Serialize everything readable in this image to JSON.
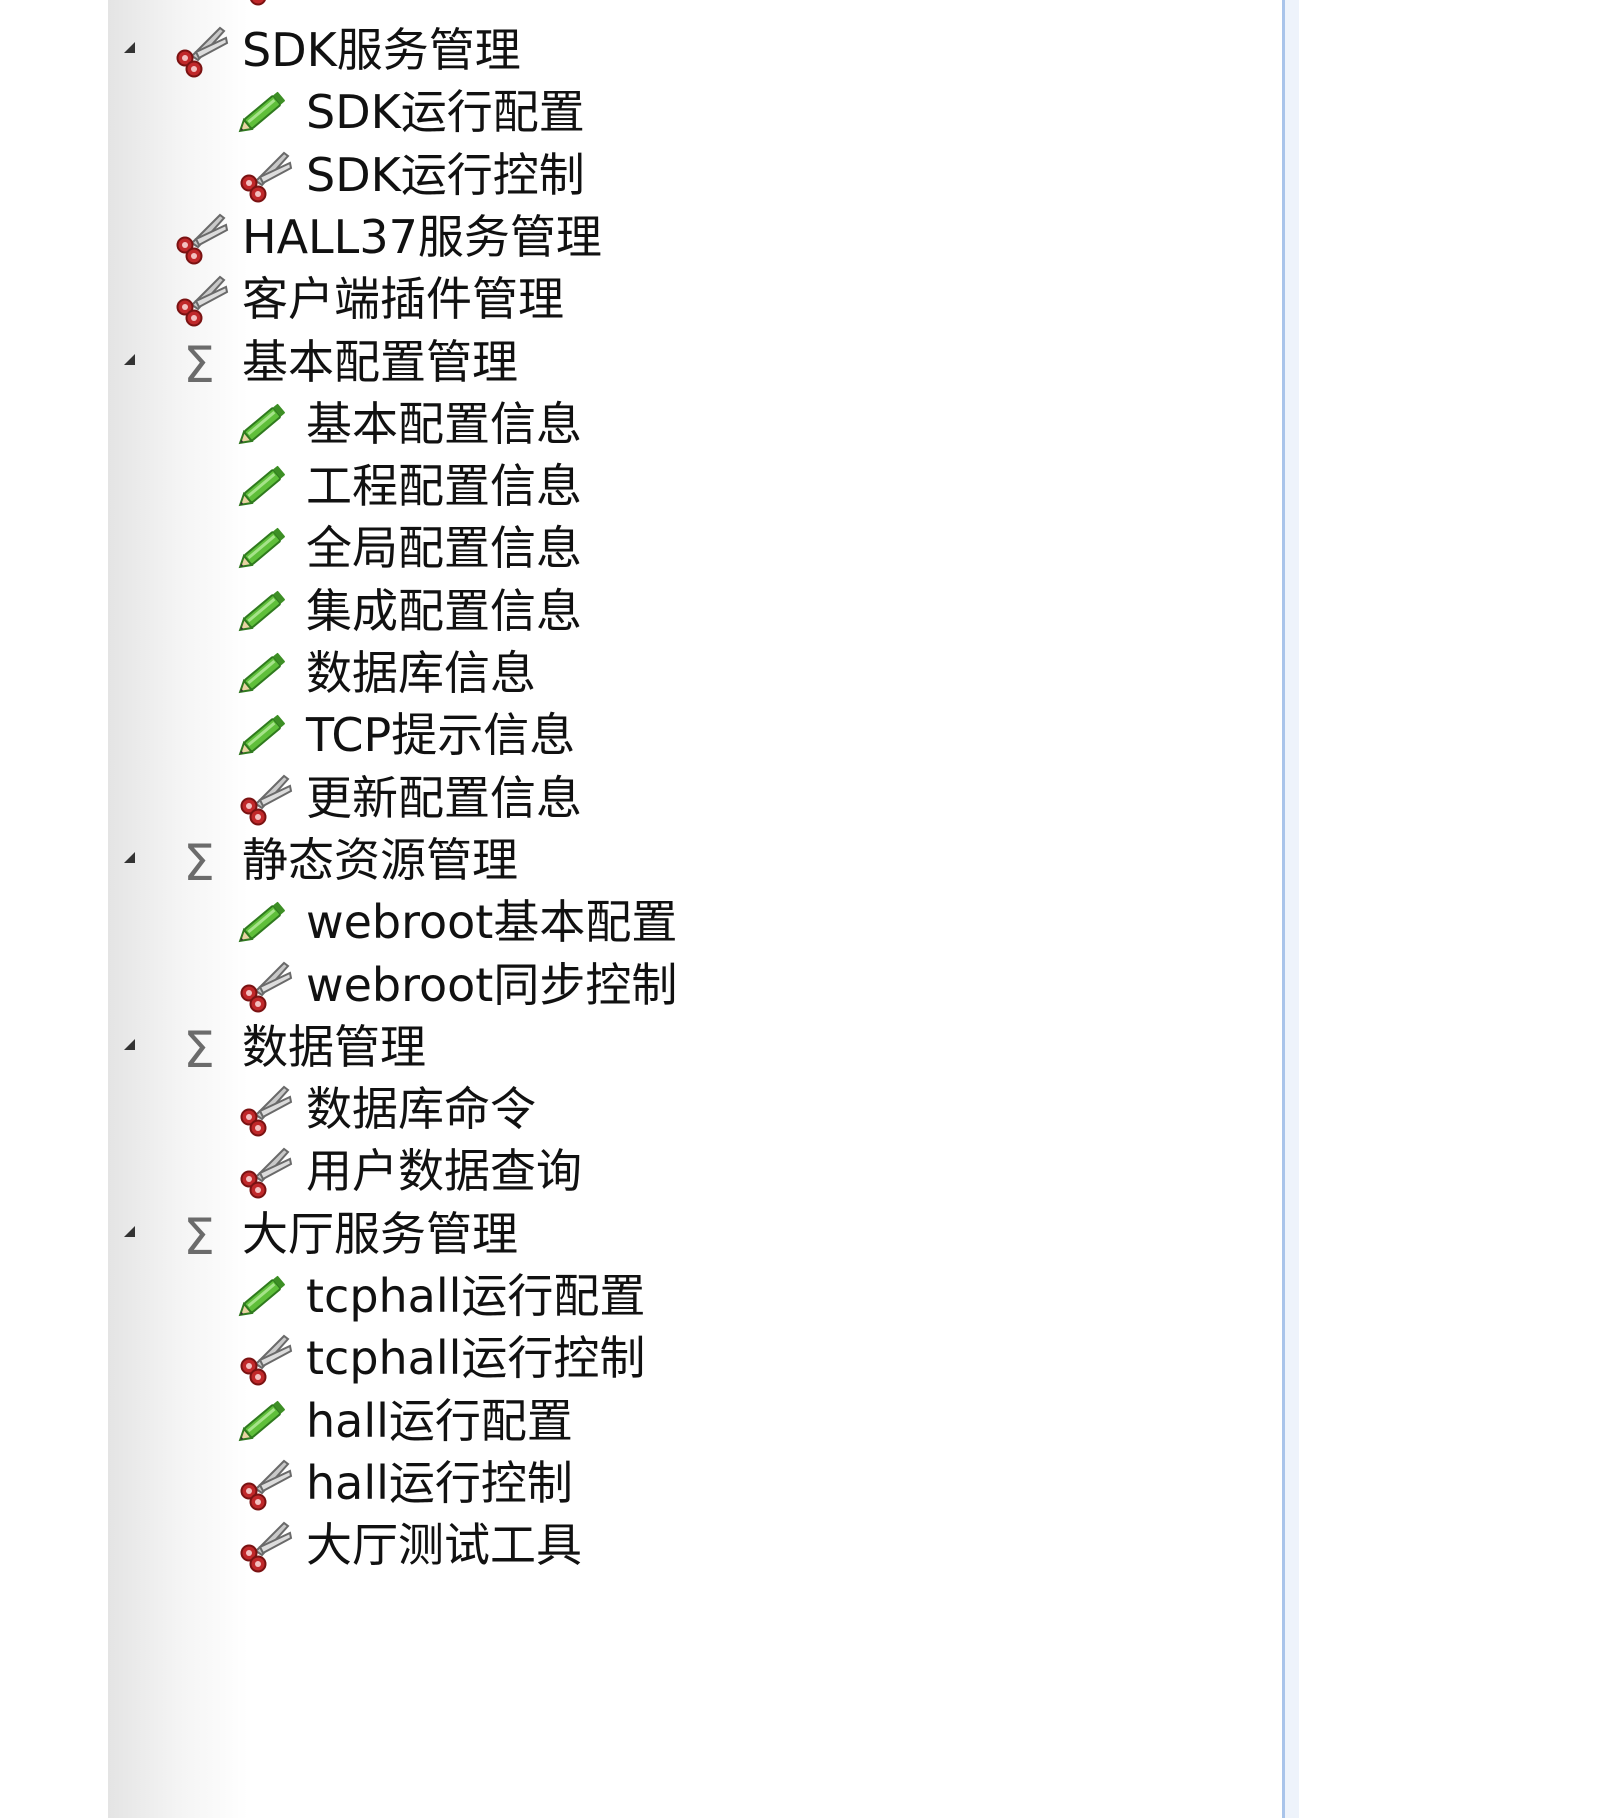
{
  "tree": {
    "items": [
      {
        "label": "SDK服务管理",
        "level": 1,
        "icon": "scissors-icon",
        "expanded": true
      },
      {
        "label": "SDK运行配置",
        "level": 2,
        "icon": "pencil-icon"
      },
      {
        "label": "SDK运行控制",
        "level": 2,
        "icon": "scissors-icon"
      },
      {
        "label": "HALL37服务管理",
        "level": 1,
        "icon": "scissors-icon"
      },
      {
        "label": "客户端插件管理",
        "level": 1,
        "icon": "scissors-icon"
      },
      {
        "label": "基本配置管理",
        "level": 1,
        "icon": "sigma-icon",
        "expanded": true
      },
      {
        "label": "基本配置信息",
        "level": 2,
        "icon": "pencil-icon"
      },
      {
        "label": "工程配置信息",
        "level": 2,
        "icon": "pencil-icon"
      },
      {
        "label": "全局配置信息",
        "level": 2,
        "icon": "pencil-icon"
      },
      {
        "label": "集成配置信息",
        "level": 2,
        "icon": "pencil-icon"
      },
      {
        "label": "数据库信息",
        "level": 2,
        "icon": "pencil-icon"
      },
      {
        "label": "TCP提示信息",
        "level": 2,
        "icon": "pencil-icon"
      },
      {
        "label": "更新配置信息",
        "level": 2,
        "icon": "scissors-icon"
      },
      {
        "label": "静态资源管理",
        "level": 1,
        "icon": "sigma-icon",
        "expanded": true
      },
      {
        "label": "webroot基本配置",
        "level": 2,
        "icon": "pencil-icon"
      },
      {
        "label": "webroot同步控制",
        "level": 2,
        "icon": "scissors-icon"
      },
      {
        "label": "数据管理",
        "level": 1,
        "icon": "sigma-icon",
        "expanded": true
      },
      {
        "label": "数据库命令",
        "level": 2,
        "icon": "scissors-icon"
      },
      {
        "label": "用户数据查询",
        "level": 2,
        "icon": "scissors-icon"
      },
      {
        "label": "大厅服务管理",
        "level": 1,
        "icon": "sigma-icon",
        "expanded": true
      },
      {
        "label": "tcphall运行配置",
        "level": 2,
        "icon": "pencil-icon"
      },
      {
        "label": "tcphall运行控制",
        "level": 2,
        "icon": "scissors-icon"
      },
      {
        "label": "hall运行配置",
        "level": 2,
        "icon": "pencil-icon"
      },
      {
        "label": "hall运行控制",
        "level": 2,
        "icon": "scissors-icon"
      },
      {
        "label": "大厅测试工具",
        "level": 2,
        "icon": "scissors-icon"
      }
    ]
  },
  "colors": {
    "pencil_green": "#5fbf3a",
    "scissors_red": "#c0282a",
    "panel_border": "#a9c4ea"
  }
}
